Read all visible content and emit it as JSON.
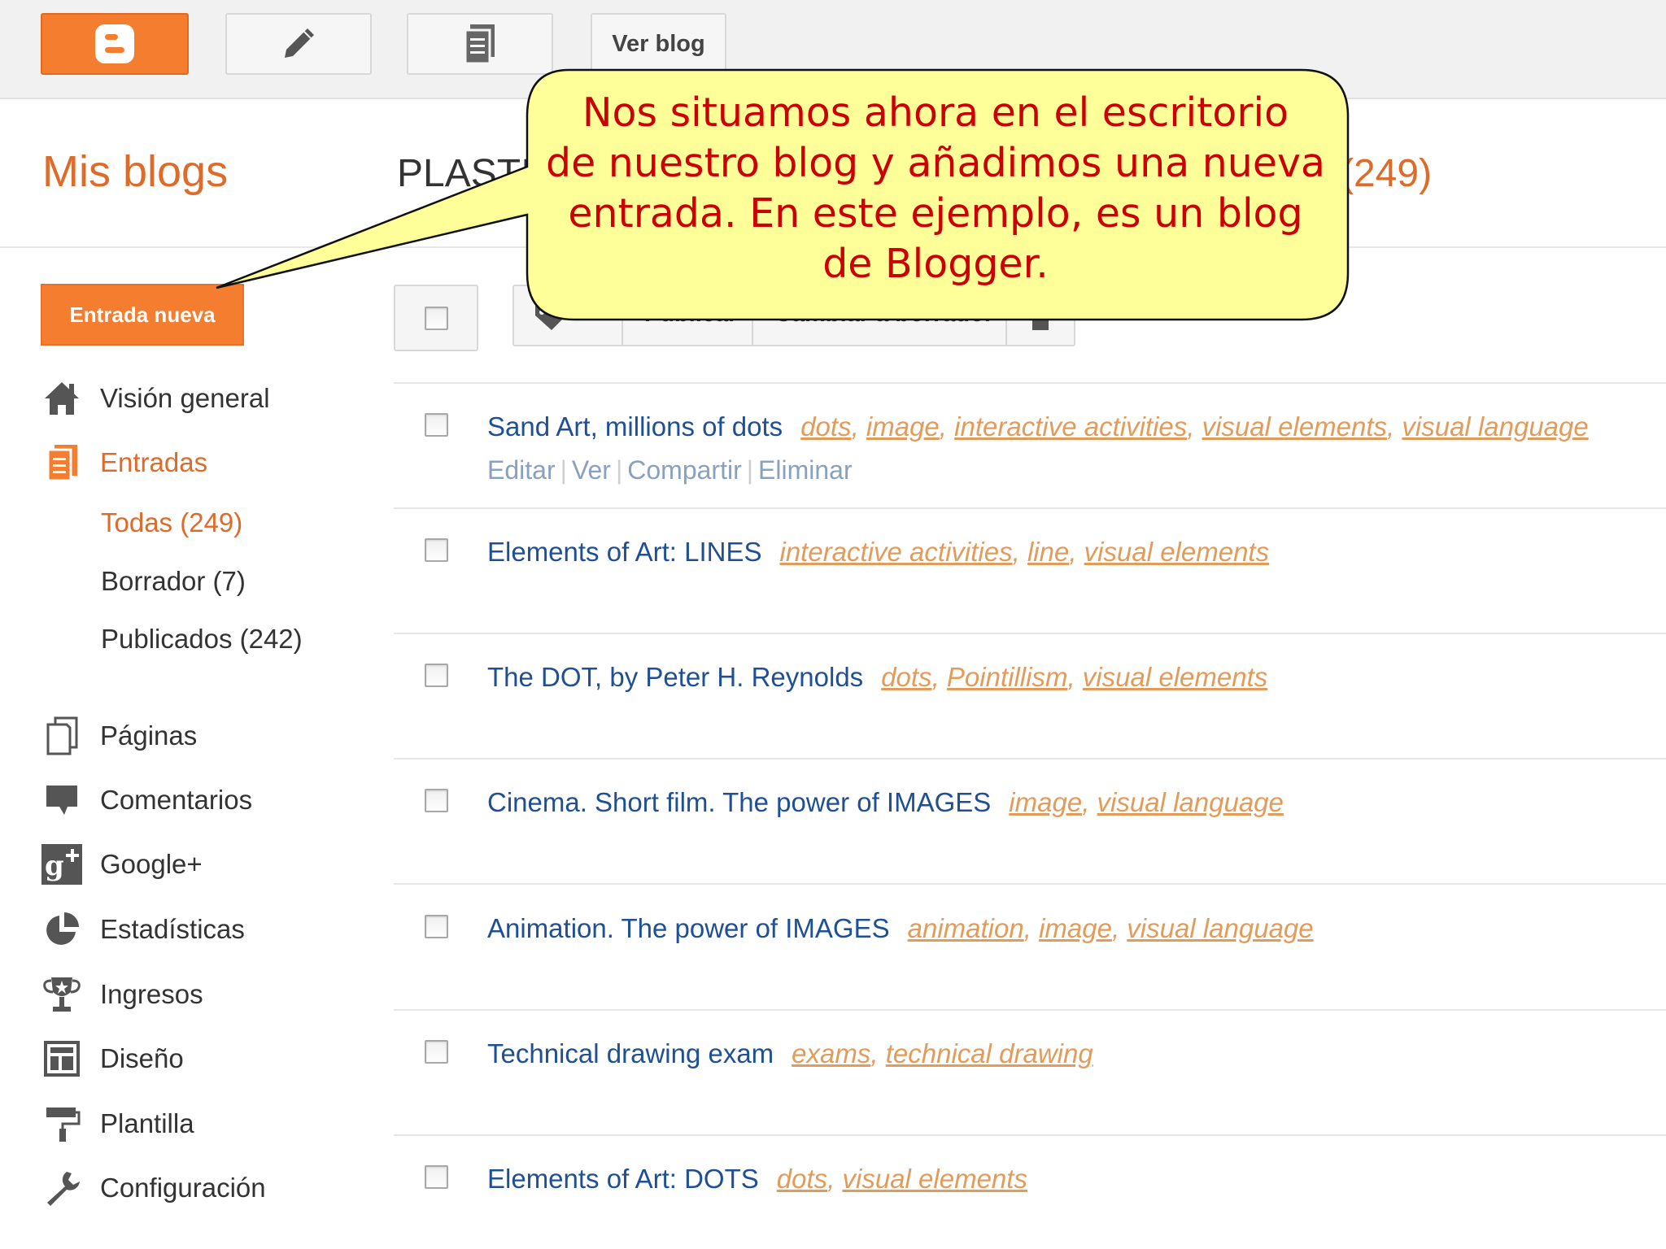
{
  "topbar": {
    "view_blog_label": "Ver blog"
  },
  "header": {
    "my_blogs": "Mis blogs",
    "blog_title": "PLASTI",
    "posts_count": "(249)"
  },
  "new_post_label": "Entrada nueva",
  "sidebar": {
    "overview": "Visión general",
    "posts": "Entradas",
    "posts_all": "Todas (249)",
    "posts_draft": "Borrador (7)",
    "posts_published": "Publicados (242)",
    "pages": "Páginas",
    "comments": "Comentarios",
    "google_plus": "Google+",
    "stats": "Estadísticas",
    "earnings": "Ingresos",
    "layout": "Diseño",
    "template": "Plantilla",
    "settings": "Configuración"
  },
  "toolbar": {
    "publish_label": "Publicar",
    "revert_label": "Cambiar a borrador"
  },
  "post_actions": {
    "edit": "Editar",
    "view": "Ver",
    "share": "Compartir",
    "delete": "Eliminar"
  },
  "posts": [
    {
      "title": "Sand Art, millions of dots",
      "labels": [
        "dots",
        "image",
        "interactive activities",
        "visual elements",
        "visual language"
      ]
    },
    {
      "title": "Elements of Art: LINES",
      "labels": [
        "interactive activities",
        "line",
        "visual elements"
      ]
    },
    {
      "title": "The DOT, by Peter H. Reynolds",
      "labels": [
        "dots",
        "Pointillism",
        "visual elements"
      ]
    },
    {
      "title": "Cinema. Short film. The power of IMAGES",
      "labels": [
        "image",
        "visual language"
      ]
    },
    {
      "title": "Animation. The power of IMAGES",
      "labels": [
        "animation",
        "image",
        "visual language"
      ]
    },
    {
      "title": "Technical drawing exam",
      "labels": [
        "exams",
        "technical drawing"
      ]
    },
    {
      "title": "Elements of Art: DOTS",
      "labels": [
        "dots",
        "visual elements"
      ]
    }
  ],
  "callout": {
    "line1": "Nos situamos ahora en el escritorio",
    "line2": "de nuestro blog y añadimos una nueva",
    "line3": "entrada. En este ejemplo, es un blog",
    "line4": "de Blogger."
  },
  "colors": {
    "accent_orange": "#f57d30",
    "post_title_blue": "#1f4f94",
    "label_orange": "#e39b5a",
    "callout_fill": "#ffff99",
    "callout_text": "#cc0000"
  }
}
